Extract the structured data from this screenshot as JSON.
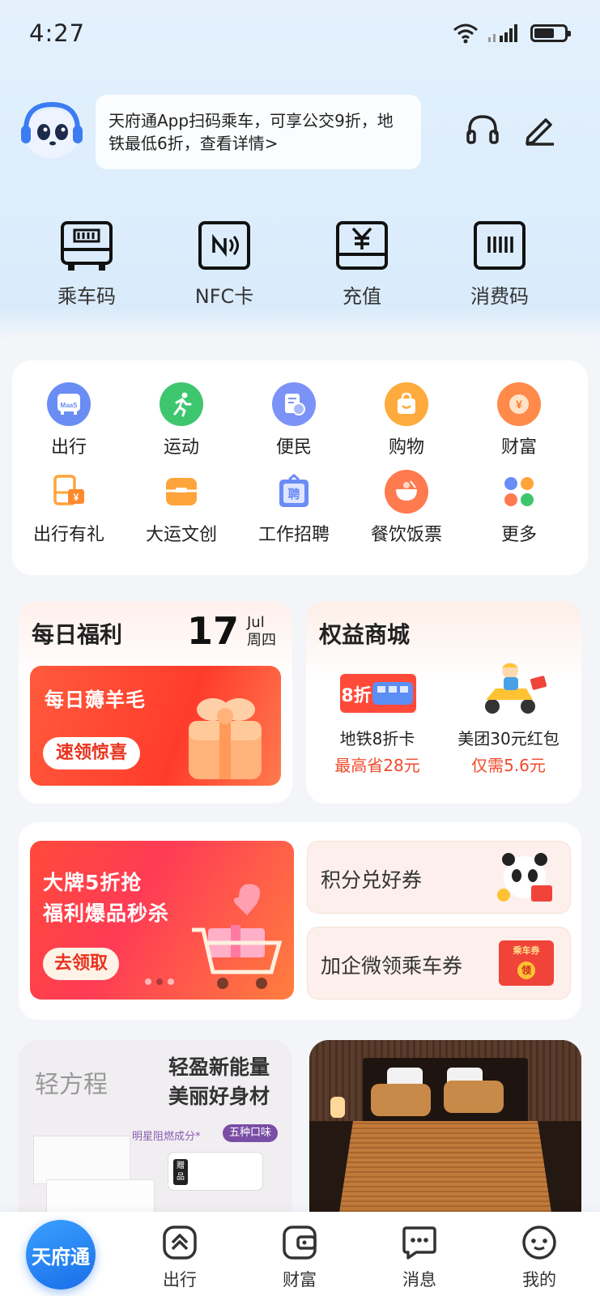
{
  "status_bar": {
    "time": "4:27"
  },
  "header": {
    "notice": "天府通App扫码乘车，可享公交9折，地铁最低6折，查看详情>",
    "quick_actions": [
      {
        "label": "乘车码",
        "icon": "ride-code-icon"
      },
      {
        "label": "NFC卡",
        "icon": "nfc-card-icon"
      },
      {
        "label": "充值",
        "icon": "recharge-icon"
      },
      {
        "label": "消费码",
        "icon": "pay-code-icon"
      }
    ]
  },
  "services": [
    {
      "label": "出行",
      "icon": "maas-icon",
      "color": "#6a8cf5"
    },
    {
      "label": "运动",
      "icon": "running-icon",
      "color": "#3ec66f"
    },
    {
      "label": "便民",
      "icon": "convenience-icon",
      "color": "#7b93f6"
    },
    {
      "label": "购物",
      "icon": "shopping-bag-icon",
      "color": "#ffaa3c"
    },
    {
      "label": "财富",
      "icon": "wealth-coin-icon",
      "color": "#ff8a4a"
    },
    {
      "label": "出行有礼",
      "icon": "bus-gift-icon",
      "color": "#ffa43a"
    },
    {
      "label": "大运文创",
      "icon": "culture-icon",
      "color": "#ffa43a"
    },
    {
      "label": "工作招聘",
      "icon": "recruit-icon",
      "color": "#6a8cf5"
    },
    {
      "label": "餐饮饭票",
      "icon": "food-bowl-icon",
      "color": "#ff7a4e"
    },
    {
      "label": "更多",
      "icon": "more-grid-icon",
      "color": "#6a8cf5"
    }
  ],
  "daily_card": {
    "title": "每日福利",
    "day": "17",
    "month": "Jul",
    "weekday": "周四",
    "banner_text": "每日薅羊毛",
    "banner_button": "速领惊喜"
  },
  "rights_card": {
    "title": "权益商城",
    "items": [
      {
        "name": "地铁8折卡",
        "sub": "最高省28元",
        "badge": "8折"
      },
      {
        "name": "美团30元红包",
        "sub": "仅需5.6元"
      }
    ]
  },
  "promo": {
    "line1": "大牌5折抢",
    "line2": "福利爆品秒杀",
    "button": "去领取",
    "card1": "积分兑好券",
    "card2": "加企微领乘车券",
    "card2_badge_top": "乘车券",
    "card2_badge_bottom": "领"
  },
  "ads": {
    "left_brand": "轻方程",
    "left_h1": "轻盈新能量",
    "left_h2": "美丽好身材",
    "left_tagline": "明星阻燃成分*",
    "left_badge": "五种口味",
    "left_gift": "赠品"
  },
  "tabbar": {
    "home": "天府通",
    "tabs": [
      {
        "label": "出行",
        "icon": "travel-tab-icon"
      },
      {
        "label": "财富",
        "icon": "wallet-tab-icon"
      },
      {
        "label": "消息",
        "icon": "message-tab-icon"
      },
      {
        "label": "我的",
        "icon": "profile-tab-icon"
      }
    ]
  }
}
